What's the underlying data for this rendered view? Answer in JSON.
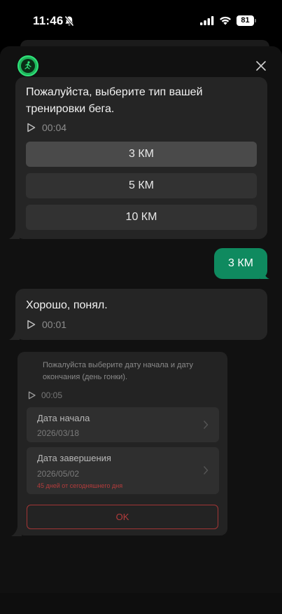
{
  "status_bar": {
    "time": "11:46",
    "battery": "81",
    "icons": [
      "bell-off-icon",
      "signal-icon",
      "wifi-icon",
      "battery-icon"
    ]
  },
  "header": {
    "avatar_icon": "runner-logo-icon",
    "close_icon": "close-icon"
  },
  "messages": {
    "bot_question": {
      "text_line1": "Пожалуйста, выберите тип вашей",
      "text_line2": "тренировки бега.",
      "audio_duration": "00:04"
    },
    "options": [
      {
        "label": "3 КМ",
        "selected": true
      },
      {
        "label": "5 КМ",
        "selected": false
      },
      {
        "label": "10 КМ",
        "selected": false
      }
    ],
    "user_reply": "3 КМ",
    "bot_ack": {
      "text": "Хорошо, понял.",
      "audio_duration": "00:01"
    },
    "date_picker": {
      "intro_line1": "Пожалуйста выберите дату начала и дату",
      "intro_line2": "окончания (день гонки).",
      "audio_duration": "00:05",
      "start": {
        "label": "Дата начала",
        "value": "2026/03/18"
      },
      "end": {
        "label": "Дата завершения",
        "value": "2026/05/02",
        "note": "45 дней от сегодняшнего дня"
      },
      "ok_label": "OK"
    }
  },
  "colors": {
    "accent_green": "#0f8a5f",
    "danger_red": "#b43c3c",
    "bubble_bg": "#252525",
    "sheet_bg": "#111111"
  }
}
